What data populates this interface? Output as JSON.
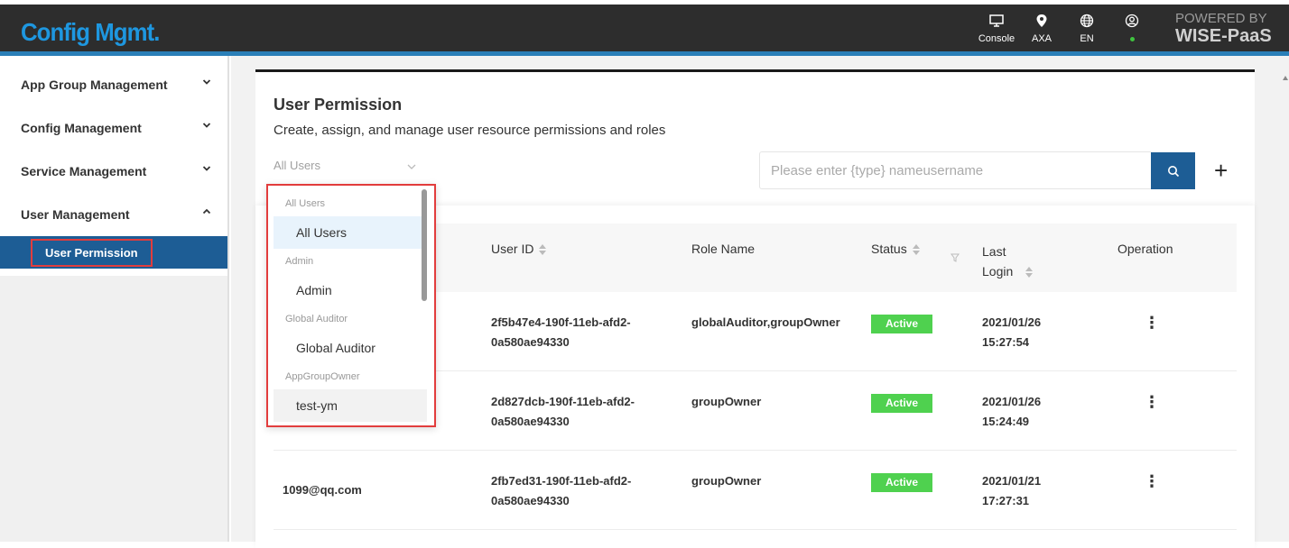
{
  "header": {
    "brand": "Config Mgmt.",
    "icons": [
      {
        "label": "Console",
        "icon": "monitor-icon"
      },
      {
        "label": "AXA",
        "icon": "location-pin-icon"
      },
      {
        "label": "EN",
        "icon": "globe-icon"
      },
      {
        "label": "",
        "icon": "user-icon"
      }
    ],
    "powered_by": "POWERED BY",
    "platform": "WISE-PaaS",
    "status_color": "#3fc33f"
  },
  "sidebar": {
    "items": [
      {
        "label": "App Group Management"
      },
      {
        "label": "Config Management"
      },
      {
        "label": "Service Management"
      },
      {
        "label": "User Management"
      }
    ],
    "active_sub": "User Permission"
  },
  "page": {
    "title": "User Permission",
    "description": "Create, assign, and manage user resource permissions and roles",
    "filter_value": "All Users",
    "search_placeholder": "Please enter {type} nameusername",
    "plus": "+"
  },
  "table": {
    "headers": {
      "user_id": "User ID",
      "role_name": "Role Name",
      "status": "Status",
      "last_login_1": "Last",
      "last_login_2": "Login",
      "operation": "Operation"
    },
    "rows": [
      {
        "user": "",
        "id1": "2f5b47e4-190f-11eb-afd2-",
        "id2": "0a580ae94330",
        "role": "globalAuditor,groupOwner",
        "status": "Active",
        "date": "2021/01/26",
        "time": "15:27:54"
      },
      {
        "user": "",
        "id1": "2d827dcb-190f-11eb-afd2-",
        "id2": "0a580ae94330",
        "role": "groupOwner",
        "status": "Active",
        "date": "2021/01/26",
        "time": "15:24:49"
      },
      {
        "user": "1099@qq.com",
        "id1": "2fb7ed31-190f-11eb-afd2-",
        "id2": "0a580ae94330",
        "role": "groupOwner",
        "status": "Active",
        "date": "2021/01/21",
        "time": "17:27:31"
      }
    ],
    "kebab": "⋮"
  },
  "dropdown": {
    "groups": [
      {
        "group": "All Users",
        "options": [
          "All Users"
        ]
      },
      {
        "group": "Admin",
        "options": [
          "Admin"
        ]
      },
      {
        "group": "Global Auditor",
        "options": [
          "Global Auditor"
        ]
      },
      {
        "group": "AppGroupOwner",
        "options": [
          "test-ym"
        ]
      }
    ],
    "selected": "All Users",
    "hovered": "test-ym"
  }
}
